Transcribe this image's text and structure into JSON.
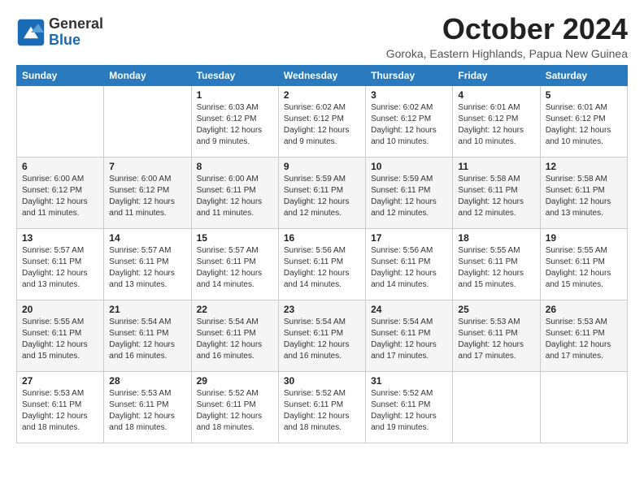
{
  "logo": {
    "general": "General",
    "blue": "Blue"
  },
  "title": "October 2024",
  "subtitle": "Goroka, Eastern Highlands, Papua New Guinea",
  "days_of_week": [
    "Sunday",
    "Monday",
    "Tuesday",
    "Wednesday",
    "Thursday",
    "Friday",
    "Saturday"
  ],
  "weeks": [
    [
      {
        "day": "",
        "info": ""
      },
      {
        "day": "",
        "info": ""
      },
      {
        "day": "1",
        "info": "Sunrise: 6:03 AM\nSunset: 6:12 PM\nDaylight: 12 hours and 9 minutes."
      },
      {
        "day": "2",
        "info": "Sunrise: 6:02 AM\nSunset: 6:12 PM\nDaylight: 12 hours and 9 minutes."
      },
      {
        "day": "3",
        "info": "Sunrise: 6:02 AM\nSunset: 6:12 PM\nDaylight: 12 hours and 10 minutes."
      },
      {
        "day": "4",
        "info": "Sunrise: 6:01 AM\nSunset: 6:12 PM\nDaylight: 12 hours and 10 minutes."
      },
      {
        "day": "5",
        "info": "Sunrise: 6:01 AM\nSunset: 6:12 PM\nDaylight: 12 hours and 10 minutes."
      }
    ],
    [
      {
        "day": "6",
        "info": "Sunrise: 6:00 AM\nSunset: 6:12 PM\nDaylight: 12 hours and 11 minutes."
      },
      {
        "day": "7",
        "info": "Sunrise: 6:00 AM\nSunset: 6:12 PM\nDaylight: 12 hours and 11 minutes."
      },
      {
        "day": "8",
        "info": "Sunrise: 6:00 AM\nSunset: 6:11 PM\nDaylight: 12 hours and 11 minutes."
      },
      {
        "day": "9",
        "info": "Sunrise: 5:59 AM\nSunset: 6:11 PM\nDaylight: 12 hours and 12 minutes."
      },
      {
        "day": "10",
        "info": "Sunrise: 5:59 AM\nSunset: 6:11 PM\nDaylight: 12 hours and 12 minutes."
      },
      {
        "day": "11",
        "info": "Sunrise: 5:58 AM\nSunset: 6:11 PM\nDaylight: 12 hours and 12 minutes."
      },
      {
        "day": "12",
        "info": "Sunrise: 5:58 AM\nSunset: 6:11 PM\nDaylight: 12 hours and 13 minutes."
      }
    ],
    [
      {
        "day": "13",
        "info": "Sunrise: 5:57 AM\nSunset: 6:11 PM\nDaylight: 12 hours and 13 minutes."
      },
      {
        "day": "14",
        "info": "Sunrise: 5:57 AM\nSunset: 6:11 PM\nDaylight: 12 hours and 13 minutes."
      },
      {
        "day": "15",
        "info": "Sunrise: 5:57 AM\nSunset: 6:11 PM\nDaylight: 12 hours and 14 minutes."
      },
      {
        "day": "16",
        "info": "Sunrise: 5:56 AM\nSunset: 6:11 PM\nDaylight: 12 hours and 14 minutes."
      },
      {
        "day": "17",
        "info": "Sunrise: 5:56 AM\nSunset: 6:11 PM\nDaylight: 12 hours and 14 minutes."
      },
      {
        "day": "18",
        "info": "Sunrise: 5:55 AM\nSunset: 6:11 PM\nDaylight: 12 hours and 15 minutes."
      },
      {
        "day": "19",
        "info": "Sunrise: 5:55 AM\nSunset: 6:11 PM\nDaylight: 12 hours and 15 minutes."
      }
    ],
    [
      {
        "day": "20",
        "info": "Sunrise: 5:55 AM\nSunset: 6:11 PM\nDaylight: 12 hours and 15 minutes."
      },
      {
        "day": "21",
        "info": "Sunrise: 5:54 AM\nSunset: 6:11 PM\nDaylight: 12 hours and 16 minutes."
      },
      {
        "day": "22",
        "info": "Sunrise: 5:54 AM\nSunset: 6:11 PM\nDaylight: 12 hours and 16 minutes."
      },
      {
        "day": "23",
        "info": "Sunrise: 5:54 AM\nSunset: 6:11 PM\nDaylight: 12 hours and 16 minutes."
      },
      {
        "day": "24",
        "info": "Sunrise: 5:54 AM\nSunset: 6:11 PM\nDaylight: 12 hours and 17 minutes."
      },
      {
        "day": "25",
        "info": "Sunrise: 5:53 AM\nSunset: 6:11 PM\nDaylight: 12 hours and 17 minutes."
      },
      {
        "day": "26",
        "info": "Sunrise: 5:53 AM\nSunset: 6:11 PM\nDaylight: 12 hours and 17 minutes."
      }
    ],
    [
      {
        "day": "27",
        "info": "Sunrise: 5:53 AM\nSunset: 6:11 PM\nDaylight: 12 hours and 18 minutes."
      },
      {
        "day": "28",
        "info": "Sunrise: 5:53 AM\nSunset: 6:11 PM\nDaylight: 12 hours and 18 minutes."
      },
      {
        "day": "29",
        "info": "Sunrise: 5:52 AM\nSunset: 6:11 PM\nDaylight: 12 hours and 18 minutes."
      },
      {
        "day": "30",
        "info": "Sunrise: 5:52 AM\nSunset: 6:11 PM\nDaylight: 12 hours and 18 minutes."
      },
      {
        "day": "31",
        "info": "Sunrise: 5:52 AM\nSunset: 6:11 PM\nDaylight: 12 hours and 19 minutes."
      },
      {
        "day": "",
        "info": ""
      },
      {
        "day": "",
        "info": ""
      }
    ]
  ]
}
